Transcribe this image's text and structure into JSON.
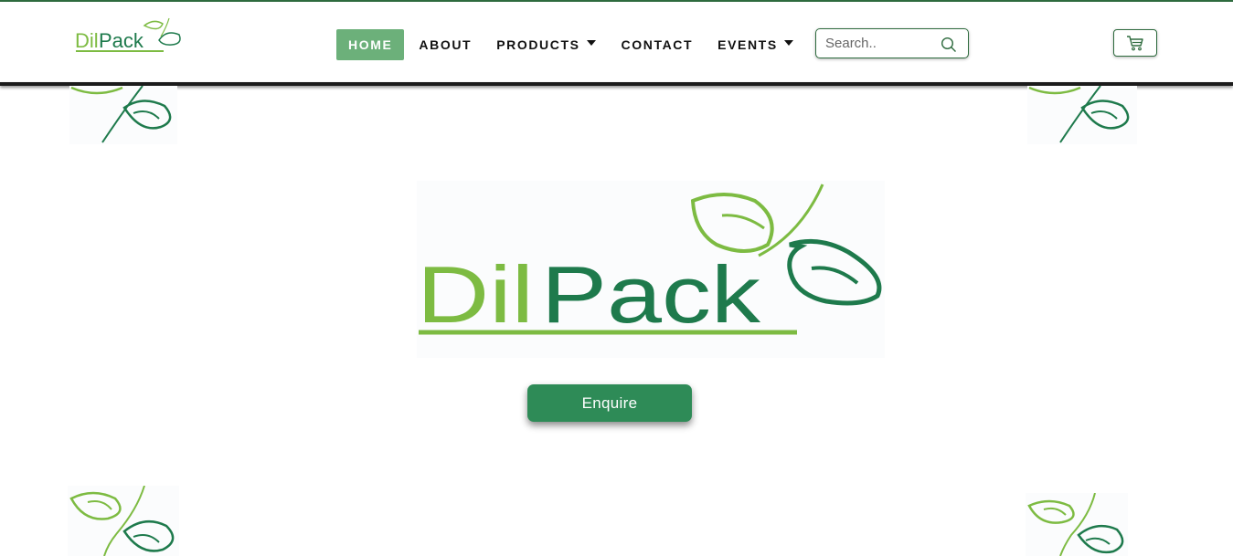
{
  "brand": {
    "name": "DilPack",
    "name_part1": "Dil",
    "name_part2": "Pack"
  },
  "nav": {
    "items": [
      {
        "label": "HOME",
        "active": true,
        "dropdown": false
      },
      {
        "label": "ABOUT",
        "active": false,
        "dropdown": false
      },
      {
        "label": "PRODUCTS",
        "active": false,
        "dropdown": true
      },
      {
        "label": "CONTACT",
        "active": false,
        "dropdown": false
      },
      {
        "label": "EVENTS",
        "active": false,
        "dropdown": true
      }
    ]
  },
  "search": {
    "placeholder": "Search..",
    "value": "",
    "icon": "search-icon"
  },
  "cart": {
    "icon": "cart-icon"
  },
  "hero": {
    "cta_label": "Enquire"
  },
  "colors": {
    "accent_dark": "#2e6b3e",
    "nav_active_bg": "#6cb07a",
    "light_green": "#7dbb42",
    "dark_green": "#1e7a4c",
    "button_bg": "#2e8b57"
  }
}
